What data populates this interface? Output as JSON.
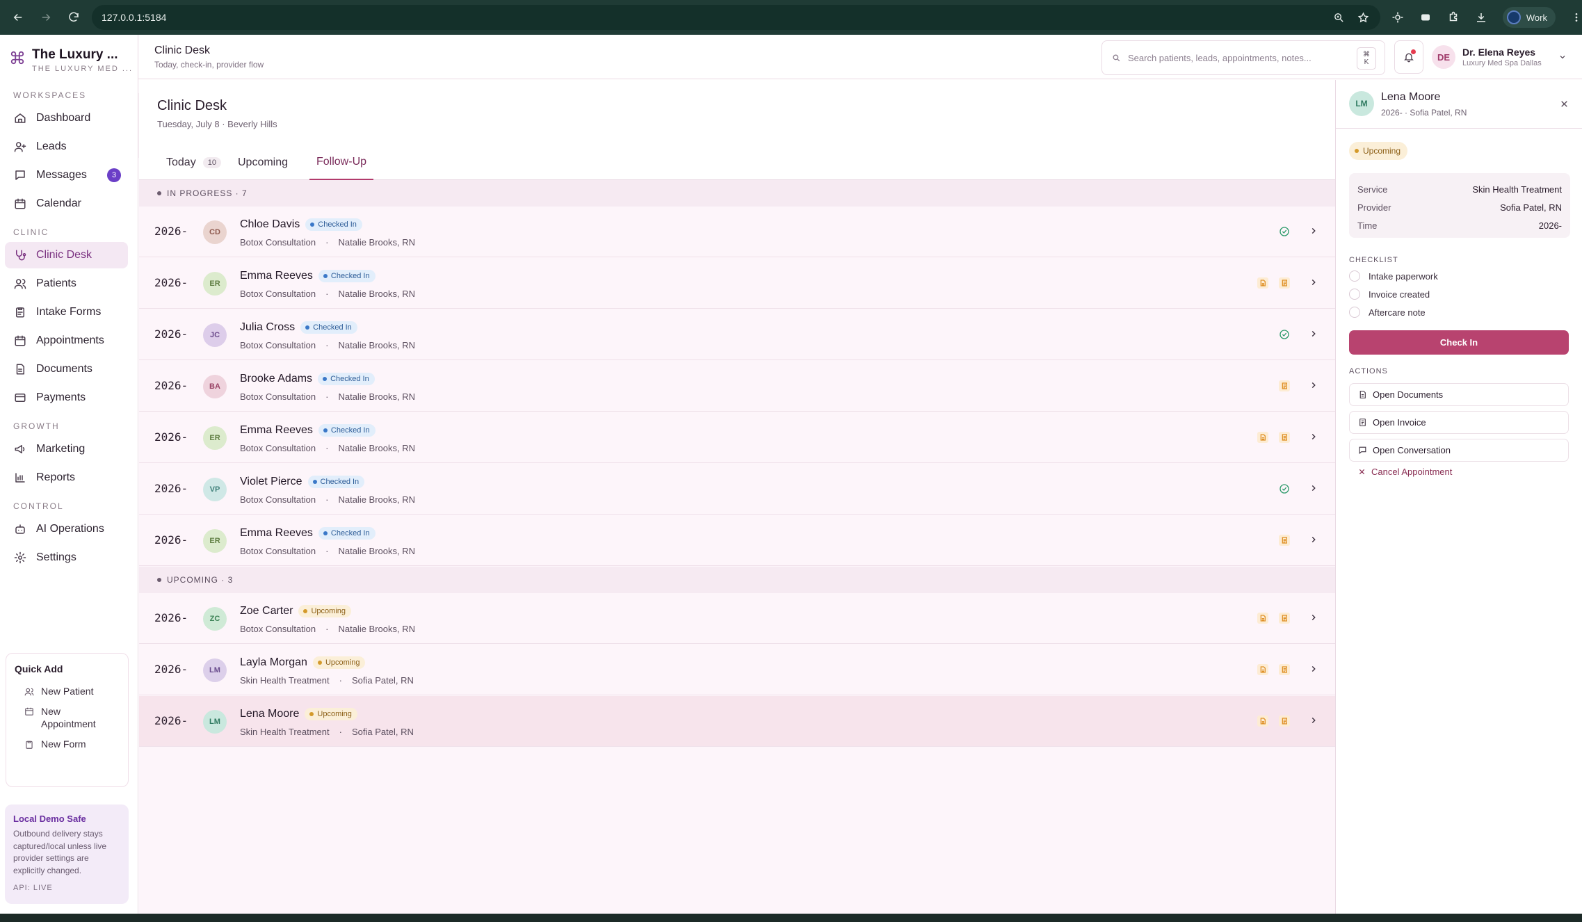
{
  "browser": {
    "url": "127.0.0.1:5184",
    "profile_label": "Work"
  },
  "brand": {
    "name": "The Luxury ...",
    "subtitle": "THE LUXURY MED ..."
  },
  "sidebar": {
    "sections": {
      "workspaces": "WORKSPACES",
      "clinic": "CLINIC",
      "growth": "GROWTH",
      "control": "CONTROL"
    },
    "items": [
      {
        "label": "Dashboard",
        "icon": "home-icon"
      },
      {
        "label": "Leads",
        "icon": "user-plus-icon"
      },
      {
        "label": "Messages",
        "icon": "chat-icon",
        "badge": "3"
      },
      {
        "label": "Calendar",
        "icon": "calendar-icon"
      },
      {
        "label": "Clinic Desk",
        "icon": "stethoscope-icon",
        "active": true
      },
      {
        "label": "Patients",
        "icon": "users-icon"
      },
      {
        "label": "Intake Forms",
        "icon": "clipboard-icon"
      },
      {
        "label": "Appointments",
        "icon": "calendar-icon"
      },
      {
        "label": "Documents",
        "icon": "document-icon"
      },
      {
        "label": "Payments",
        "icon": "credit-card-icon"
      },
      {
        "label": "Marketing",
        "icon": "megaphone-icon"
      },
      {
        "label": "Reports",
        "icon": "bar-chart-icon"
      },
      {
        "label": "AI Operations",
        "icon": "bot-icon"
      },
      {
        "label": "Settings",
        "icon": "gear-icon"
      }
    ],
    "quick_add": {
      "title": "Quick Add",
      "items": [
        "New Patient",
        "New Appointment",
        "New Form"
      ]
    },
    "demo": {
      "title": "Local Demo Safe",
      "body": "Outbound delivery stays captured/local unless live provider settings are explicitly changed.",
      "api": "API: LIVE"
    }
  },
  "header": {
    "title": "Clinic Desk",
    "subtitle": "Today, check-in, provider flow",
    "search_placeholder": "Search patients, leads, appointments, notes...",
    "kbd_top": "⌘",
    "kbd_bottom": "K",
    "user": {
      "initials": "DE",
      "name": "Dr. Elena Reyes",
      "org": "Luxury Med Spa Dallas"
    }
  },
  "main": {
    "title": "Clinic Desk",
    "subtitle": "Tuesday, July 8 · Beverly Hills",
    "tabs": [
      {
        "label": "Today",
        "count": "10"
      },
      {
        "label": "Upcoming"
      },
      {
        "label": "Follow-Up",
        "active": true
      }
    ],
    "groups": [
      {
        "label": "IN PROGRESS · 7",
        "rows": [
          {
            "time": "2026-",
            "initials": "CD",
            "name": "Chloe Davis",
            "status": "Checked In",
            "service": "Botox Consultation",
            "provider": "Natalie Brooks, RN",
            "icons": [
              "check"
            ],
            "avatar_bg": "#ead4cf",
            "avatar_fg": "#8f5a4f"
          },
          {
            "time": "2026-",
            "initials": "ER",
            "name": "Emma Reeves",
            "status": "Checked In",
            "service": "Botox Consultation",
            "provider": "Natalie Brooks, RN",
            "icons": [
              "doc",
              "invoice"
            ],
            "avatar_bg": "#dcebcd",
            "avatar_fg": "#5f7e42"
          },
          {
            "time": "2026-",
            "initials": "JC",
            "name": "Julia Cross",
            "status": "Checked In",
            "service": "Botox Consultation",
            "provider": "Natalie Brooks, RN",
            "icons": [
              "check"
            ],
            "avatar_bg": "#ddcdea",
            "avatar_fg": "#6d4c8c"
          },
          {
            "time": "2026-",
            "initials": "BA",
            "name": "Brooke Adams",
            "status": "Checked In",
            "service": "Botox Consultation",
            "provider": "Natalie Brooks, RN",
            "icons": [
              "invoice"
            ],
            "avatar_bg": "#efd3dd",
            "avatar_fg": "#9a4466"
          },
          {
            "time": "2026-",
            "initials": "ER",
            "name": "Emma Reeves",
            "status": "Checked In",
            "service": "Botox Consultation",
            "provider": "Natalie Brooks, RN",
            "icons": [
              "doc",
              "invoice"
            ],
            "avatar_bg": "#dcebcd",
            "avatar_fg": "#5f7e42"
          },
          {
            "time": "2026-",
            "initials": "VP",
            "name": "Violet Pierce",
            "status": "Checked In",
            "service": "Botox Consultation",
            "provider": "Natalie Brooks, RN",
            "icons": [
              "check"
            ],
            "avatar_bg": "#cfe8e6",
            "avatar_fg": "#3f807a"
          },
          {
            "time": "2026-",
            "initials": "ER",
            "name": "Emma Reeves",
            "status": "Checked In",
            "service": "Botox Consultation",
            "provider": "Natalie Brooks, RN",
            "icons": [
              "invoice"
            ],
            "avatar_bg": "#dcebcd",
            "avatar_fg": "#5f7e42"
          }
        ]
      },
      {
        "label": "UPCOMING · 3",
        "rows": [
          {
            "time": "2026-",
            "initials": "ZC",
            "name": "Zoe Carter",
            "status": "Upcoming",
            "service": "Botox Consultation",
            "provider": "Natalie Brooks, RN",
            "icons": [
              "doc",
              "invoice"
            ],
            "avatar_bg": "#cfead6",
            "avatar_fg": "#3e8458"
          },
          {
            "time": "2026-",
            "initials": "LM",
            "name": "Layla Morgan",
            "status": "Upcoming",
            "service": "Skin Health Treatment",
            "provider": "Sofia Patel, RN",
            "icons": [
              "doc",
              "invoice"
            ],
            "avatar_bg": "#dccfea",
            "avatar_fg": "#6a4c8e"
          },
          {
            "time": "2026-",
            "initials": "LM",
            "name": "Lena Moore",
            "status": "Upcoming",
            "service": "Skin Health Treatment",
            "provider": "Sofia Patel, RN",
            "icons": [
              "doc",
              "invoice"
            ],
            "avatar_bg": "#c9e8de",
            "avatar_fg": "#2f7a60",
            "selected": true
          }
        ]
      }
    ]
  },
  "panel": {
    "initials": "LM",
    "name": "Lena Moore",
    "subtitle": "2026- · Sofia Patel, RN",
    "status": "Upcoming",
    "details": [
      {
        "k": "Service",
        "v": "Skin Health Treatment"
      },
      {
        "k": "Provider",
        "v": "Sofia Patel, RN"
      },
      {
        "k": "Time",
        "v": "2026-"
      }
    ],
    "checklist_label": "CHECKLIST",
    "checklist": [
      "Intake paperwork",
      "Invoice created",
      "Aftercare note"
    ],
    "check_in": "Check In",
    "actions_label": "ACTIONS",
    "actions": [
      "Open Documents",
      "Open Invoice",
      "Open Conversation"
    ],
    "cancel": "Cancel Appointment"
  }
}
